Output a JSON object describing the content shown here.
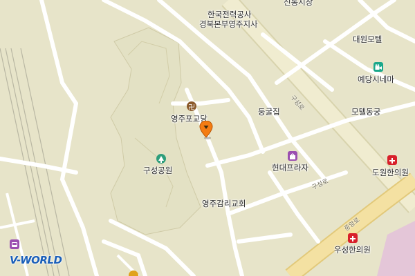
{
  "map": {
    "labels": {
      "kepco": "한국전력공사",
      "kepco_branch": "경북본부영주지사",
      "shinseung_market": "신통시장",
      "daewon_motel": "대원모텔",
      "yedang_cinema": "예당시네마",
      "motel_dunggung": "모텔동궁",
      "donggul_jip": "둥굴집",
      "yeongju_church_pogyo": "영주포교당",
      "guseong_park": "구성공원",
      "hyundai_plaza": "현대프라자",
      "dowon_clinic": "도원한의원",
      "methodist_church": "영주감리교회",
      "useong_clinic": "우성한의원"
    },
    "road_labels": {
      "guseong_ro_1": "구성로",
      "guseong_ro_2": "구성로",
      "jungang_ro": "중앙로"
    },
    "icons": {
      "temple": "temple-icon",
      "park": "park-icon",
      "shopping": "shopping-icon",
      "cinema": "cinema-icon",
      "hospital_1": "hospital-icon",
      "hospital_2": "hospital-icon",
      "marker": "location-marker-icon"
    },
    "logo": "V-WORLD",
    "colors": {
      "background": "#e7e4c9",
      "road": "#ffffff",
      "main_road": "#f4e7b4",
      "temple": "#8b5a2b",
      "park": "#2e9e7b",
      "shopping": "#9b4fb0",
      "cinema": "#1aa88b",
      "hospital": "#d8202a",
      "marker": "#f47c13",
      "logo": "#1b5fb8"
    }
  }
}
